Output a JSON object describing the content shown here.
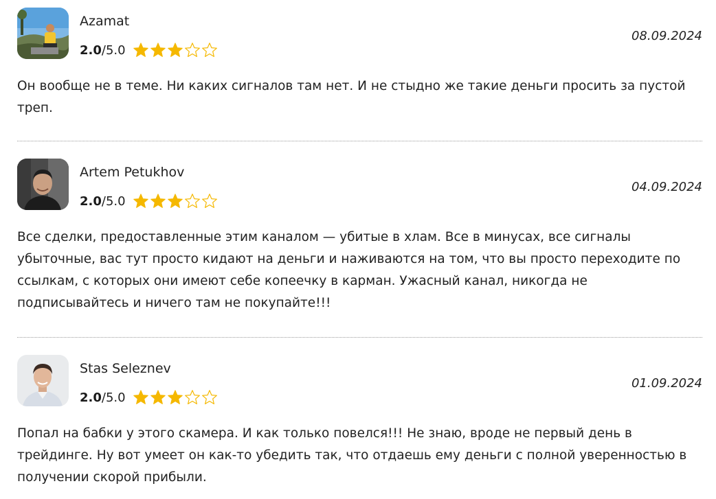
{
  "reviews": [
    {
      "author": "Azamat",
      "score": "2.0",
      "max": "/5.0",
      "stars": 3,
      "date": "08.09.2024",
      "avatar_icon": "avatar-photo-azamat-icon",
      "text": "Он вообще не в теме. Ни каких сигналов там нет. И не стыдно же такие деньги просить за пустой треп."
    },
    {
      "author": "Artem Petukhov",
      "score": "2.0",
      "max": "/5.0",
      "stars": 3,
      "date": "04.09.2024",
      "avatar_icon": "avatar-photo-artem-icon",
      "text": "Все сделки, предоставленные этим каналом — убитые в хлам. Все в минусах, все сигналы убыточные, вас тут просто кидают на деньги и наживаются на том, что вы просто переходите по ссылкам, с которых они имеют себе копеечку в карман. Ужасный канал, никогда не подписывайтесь и ничего там не покупайте!!!"
    },
    {
      "author": "Stas Seleznev",
      "score": "2.0",
      "max": "/5.0",
      "stars": 3,
      "date": "01.09.2024",
      "avatar_icon": "avatar-photo-stas-icon",
      "text": "Попал на бабки у этого скамера. И как только повелся!!! Не знаю, вроде не первый день в трейдинге. Ну вот умеет он как-то убедить так, что отдаешь ему деньги с полной уверенностью в получении скорой прибыли."
    }
  ],
  "colors": {
    "star_fill": "#f5b800",
    "star_outline": "#f5b800",
    "divider": "#9a9a9a",
    "text": "#222222"
  }
}
